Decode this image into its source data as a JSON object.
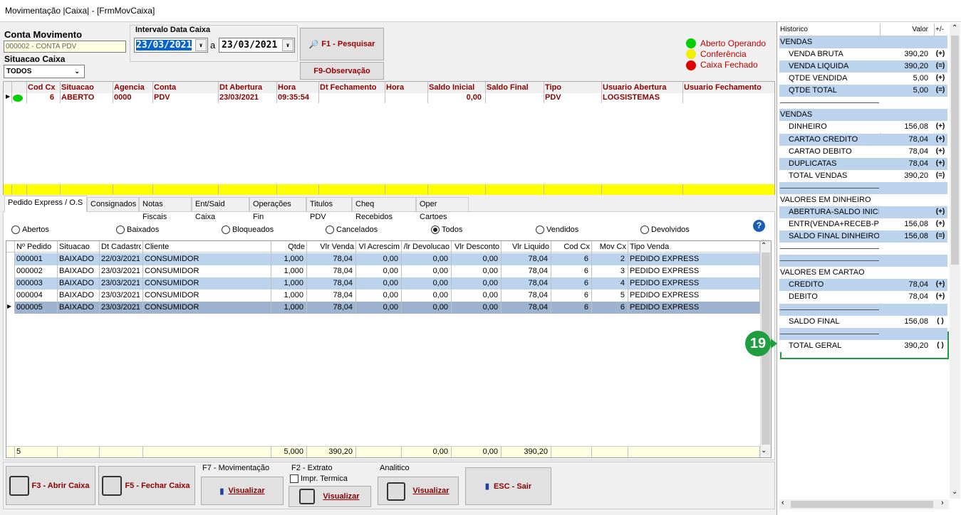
{
  "window": {
    "title": "Movimentação |Caixa| - [FrmMovCaixa]"
  },
  "filters": {
    "conta_movimento_label": "Conta Movimento",
    "conta_movimento_value": "000002 - CONTA PDV",
    "situacao_label": "Situacao Caixa",
    "situacao_value": "TODOS",
    "intervalo_label": "Intervalo Data Caixa",
    "date_from": "23/03/2021",
    "date_sep": "a",
    "date_to": "23/03/2021",
    "pesquisar_label": "F1 - Pesquisar",
    "observacao_label": "F9-Observação"
  },
  "legend": {
    "aberto": "Aberto Operando",
    "conferencia": "Conferência",
    "fechado": "Caixa Fechado",
    "colors": {
      "aberto": "#00d000",
      "conferencia": "#f0f000",
      "fechado": "#e00000"
    }
  },
  "caixa_grid": {
    "headers": [
      "Cod Cx",
      "Situacao",
      "Agencia",
      "Conta",
      "Dt Abertura",
      "Hora",
      "Dt Fechamento",
      "Hora",
      "Saldo Inicial",
      "Saldo Final",
      "Tipo",
      "Usuario Abertura",
      "Usuario Fechamento"
    ],
    "row": {
      "cod": "6",
      "situacao": "ABERTO",
      "agencia": "0000",
      "conta": "PDV",
      "dt_abertura": "23/03/2021",
      "hora": "09:35:54",
      "saldo_inicial": "0,00",
      "tipo": "PDV",
      "usuario": "LOGSISTEMAS"
    }
  },
  "tabs": [
    "Pedido Express / O.S",
    "Consignados",
    "Notas Fiscais",
    "Ent/Said Caixa",
    "Operações Fin",
    "Titulos PDV",
    "Cheq Recebidos",
    "Oper Cartoes"
  ],
  "radios": [
    "Abertos",
    "Baixados",
    "Bloqueados",
    "Cancelados",
    "Todos",
    "Vendidos",
    "Devolvidos"
  ],
  "orders": {
    "headers": [
      "Nº Pedido",
      "Situacao",
      "Dt Cadastro",
      "Cliente",
      "Qtde",
      "Vlr Venda",
      "Vl Acrescim",
      "/lr Devolucao",
      "Vlr Desconto",
      "Vlr Liquido",
      "Cod Cx",
      "Mov Cx",
      "Tipo Venda"
    ],
    "rows": [
      [
        "000001",
        "BAIXADO",
        "22/03/2021",
        "CONSUMIDOR",
        "1,000",
        "78,04",
        "0,00",
        "0,00",
        "0,00",
        "78,04",
        "6",
        "2",
        "PEDIDO EXPRESS"
      ],
      [
        "000002",
        "BAIXADO",
        "23/03/2021",
        "CONSUMIDOR",
        "1,000",
        "78,04",
        "0,00",
        "0,00",
        "0,00",
        "78,04",
        "6",
        "3",
        "PEDIDO EXPRESS"
      ],
      [
        "000003",
        "BAIXADO",
        "23/03/2021",
        "CONSUMIDOR",
        "1,000",
        "78,04",
        "0,00",
        "0,00",
        "0,00",
        "78,04",
        "6",
        "4",
        "PEDIDO EXPRESS"
      ],
      [
        "000004",
        "BAIXADO",
        "23/03/2021",
        "CONSUMIDOR",
        "1,000",
        "78,04",
        "0,00",
        "0,00",
        "0,00",
        "78,04",
        "6",
        "5",
        "PEDIDO EXPRESS"
      ],
      [
        "000005",
        "BAIXADO",
        "23/03/2021",
        "CONSUMIDOR",
        "1,000",
        "78,04",
        "0,00",
        "0,00",
        "0,00",
        "78,04",
        "6",
        "6",
        "PEDIDO EXPRESS"
      ]
    ],
    "totals": {
      "count": "5",
      "qtde": "5,000",
      "venda": "390,20",
      "devolucao": "0,00",
      "desconto": "0,00",
      "liquido": "390,20"
    }
  },
  "bottom": {
    "abrir": "F3 - Abrir Caixa",
    "fechar": "F5 - Fechar Caixa",
    "f7_label": "F7 - Movimentação",
    "f2_label": "F2 - Extrato",
    "impr_termica": "Impr. Termica",
    "analitico": "Analitico",
    "visualizar": "Visualizar",
    "sair": "ESC - Sair"
  },
  "summary": {
    "headers": {
      "historico": "Historico",
      "valor": "Valor",
      "sign": "+/-"
    },
    "rows": [
      {
        "label": "VENDAS",
        "value": "",
        "sign": "",
        "style": "section"
      },
      {
        "label": "VENDA BRUTA",
        "value": "390,20",
        "sign": "(+)",
        "style": "item"
      },
      {
        "label": "VENDA LIQUIDA",
        "value": "390,20",
        "sign": "(=)",
        "style": "item-blue"
      },
      {
        "label": "QTDE VENDIDA",
        "value": "5,00",
        "sign": "(+)",
        "style": "item"
      },
      {
        "label": "QTDE TOTAL",
        "value": "5,00",
        "sign": "(=)",
        "style": "item-blue"
      },
      {
        "label": "",
        "value": "",
        "sign": "",
        "style": "rule"
      },
      {
        "label": "VENDAS",
        "value": "",
        "sign": "",
        "style": "section"
      },
      {
        "label": "DINHEIRO",
        "value": "156,08",
        "sign": "(+)",
        "style": "item"
      },
      {
        "label": "CARTAO CREDITO",
        "value": "78,04",
        "sign": "(+)",
        "style": "item-blue"
      },
      {
        "label": "CARTAO DEBITO",
        "value": "78,04",
        "sign": "(+)",
        "style": "item"
      },
      {
        "label": "DUPLICATAS",
        "value": "78,04",
        "sign": "(+)",
        "style": "item-blue"
      },
      {
        "label": "TOTAL VENDAS",
        "value": "390,20",
        "sign": "(=)",
        "style": "item"
      },
      {
        "label": "",
        "value": "",
        "sign": "",
        "style": "rule-blue"
      },
      {
        "label": "VALORES EM DINHEIRO",
        "value": "",
        "sign": "",
        "style": "section-w"
      },
      {
        "label": "ABERTURA-SALDO INICIA",
        "value": "",
        "sign": "(+)",
        "style": "item-blue"
      },
      {
        "label": "ENTR(VENDA+RECEB-PG",
        "value": "156,08",
        "sign": "(+)",
        "style": "item"
      },
      {
        "label": "SALDO FINAL DINHEIRO",
        "value": "156,08",
        "sign": "(=)",
        "style": "item-blue"
      },
      {
        "label": "",
        "value": "",
        "sign": "",
        "style": "rule"
      },
      {
        "label": "",
        "value": "",
        "sign": "",
        "style": "rule-blue"
      },
      {
        "label": "VALORES EM CARTAO",
        "value": "",
        "sign": "",
        "style": "section-w"
      },
      {
        "label": "CREDITO",
        "value": "78,04",
        "sign": "(+)",
        "style": "item-blue"
      },
      {
        "label": "DEBITO",
        "value": "78,04",
        "sign": "(+)",
        "style": "item"
      },
      {
        "label": "",
        "value": "",
        "sign": "",
        "style": "rule-blue"
      },
      {
        "label": "SALDO FINAL",
        "value": "156,08",
        "sign": "( )",
        "style": "item"
      },
      {
        "label": "",
        "value": "",
        "sign": "",
        "style": "rule-blue"
      },
      {
        "label": "TOTAL GERAL",
        "value": "390,20",
        "sign": "( )",
        "style": "item"
      }
    ]
  },
  "callout": {
    "number": "19",
    "color": "#1e9e3e"
  }
}
